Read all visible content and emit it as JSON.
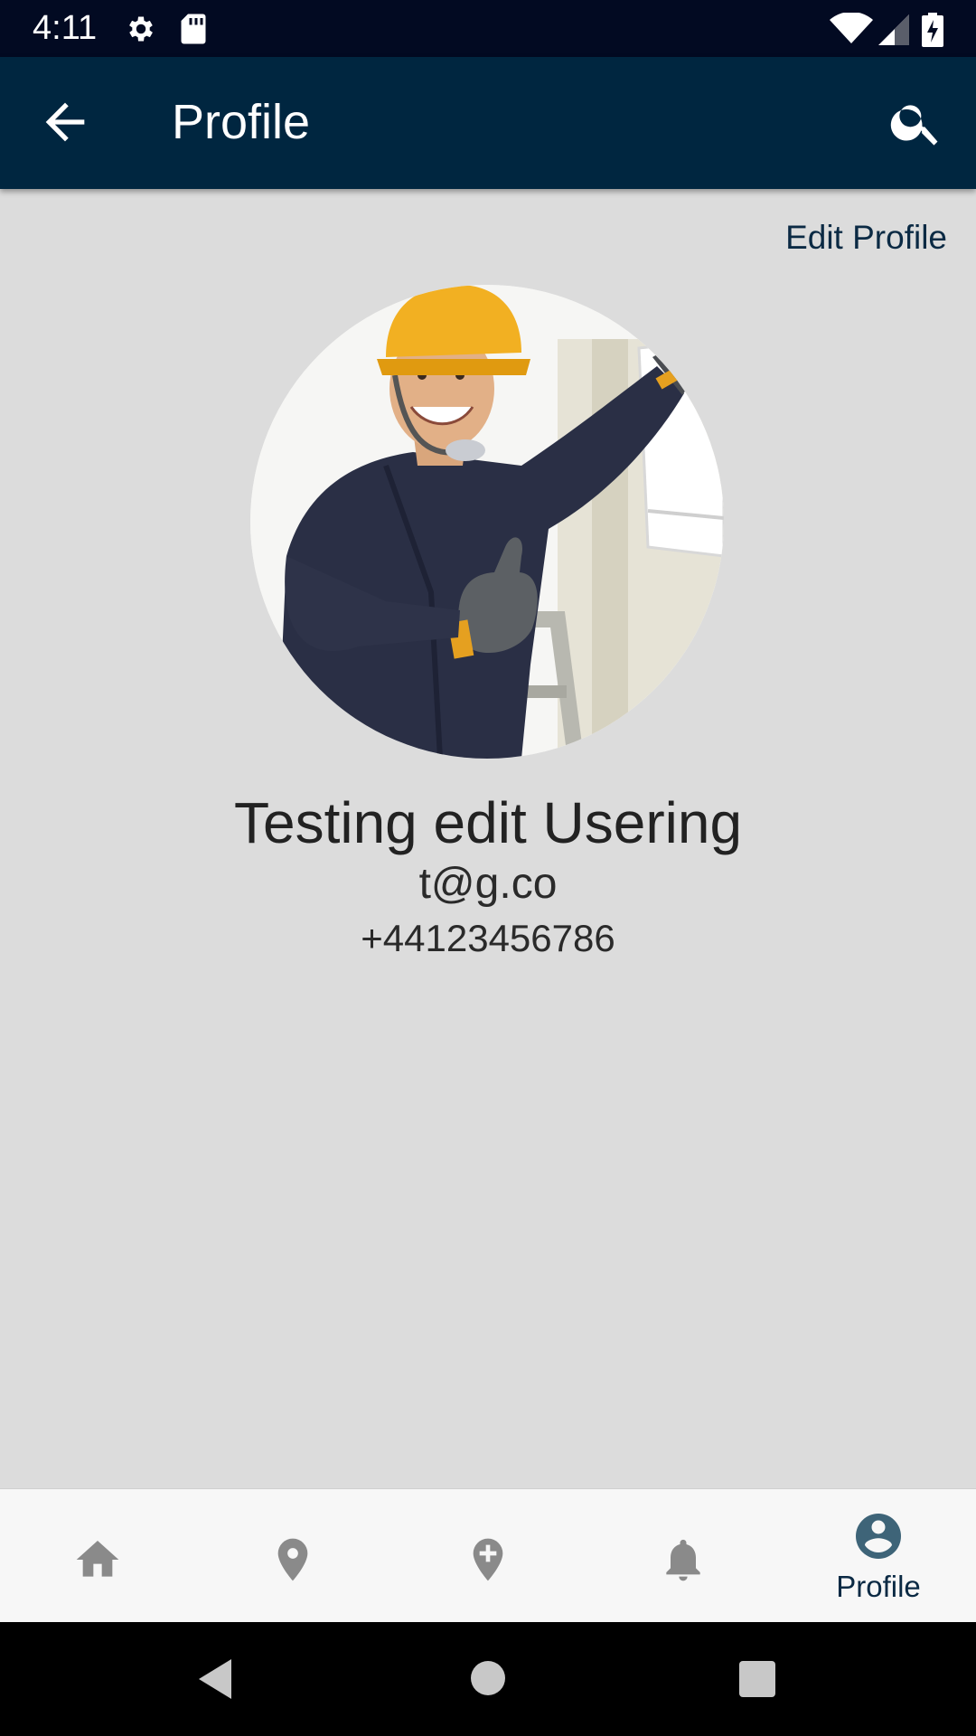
{
  "status_bar": {
    "time": "4:11",
    "icons": [
      "settings-gear-icon",
      "sd-card-icon",
      "wifi-icon",
      "cell-signal-icon",
      "battery-charging-icon"
    ]
  },
  "app_bar": {
    "title": "Profile",
    "back_icon": "arrow-left-icon",
    "search_icon": "search-icon",
    "background": "#002640"
  },
  "profile": {
    "edit_label": "Edit Profile",
    "name": "Testing edit Usering",
    "email": "t@g.co",
    "phone": "+44123456786",
    "avatar": "user-photo"
  },
  "bottom_nav": {
    "items": [
      {
        "icon": "home-icon",
        "label": "",
        "active": false
      },
      {
        "icon": "location-pin-icon",
        "label": "",
        "active": false
      },
      {
        "icon": "add-location-icon",
        "label": "",
        "active": false
      },
      {
        "icon": "bell-icon",
        "label": "",
        "active": false
      },
      {
        "icon": "account-circle-icon",
        "label": "Profile",
        "active": true
      }
    ],
    "inactive_color": "#8a8a8a",
    "active_color": "#3e6478"
  },
  "system_nav": {
    "buttons": [
      "back-triangle-icon",
      "home-circle-icon",
      "recents-square-icon"
    ]
  },
  "colors": {
    "background": "#dcdcdc",
    "status_bar": "#020a22",
    "accent_text": "#0b2a44"
  }
}
